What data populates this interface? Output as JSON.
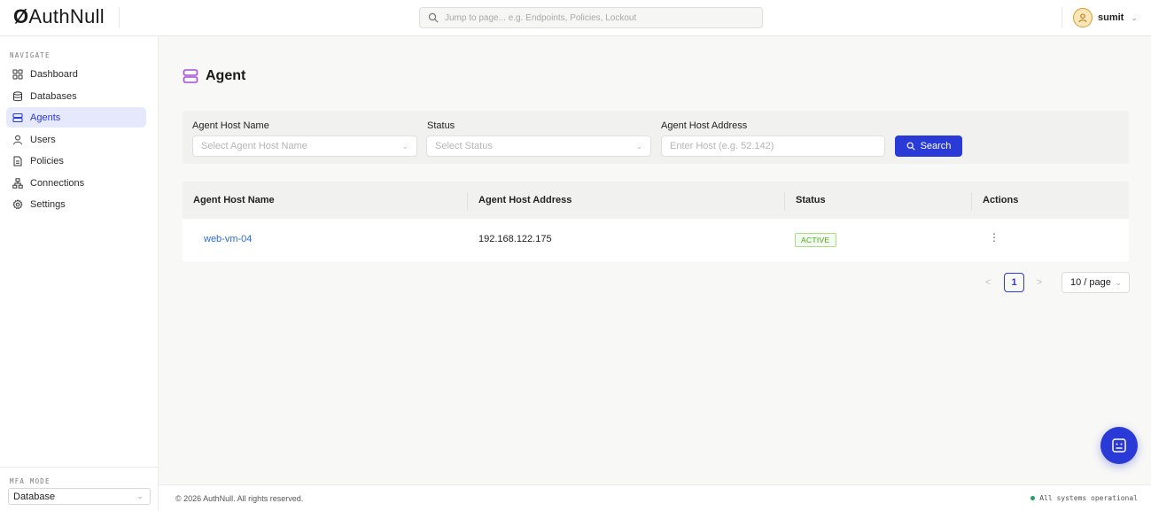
{
  "header": {
    "logo_mark": "Ø",
    "logo_text": "AuthNull",
    "search_placeholder": "Jump to page... e.g. Endpoints, Policies, Lockout",
    "user_name": "sumit"
  },
  "sidebar": {
    "section_title": "NAVIGATE",
    "items": [
      {
        "label": "Dashboard",
        "icon": "dashboard-grid-icon"
      },
      {
        "label": "Databases",
        "icon": "database-icon"
      },
      {
        "label": "Agents",
        "icon": "server-icon",
        "active": true
      },
      {
        "label": "Users",
        "icon": "user-icon"
      },
      {
        "label": "Policies",
        "icon": "document-icon"
      },
      {
        "label": "Connections",
        "icon": "network-icon"
      },
      {
        "label": "Settings",
        "icon": "gear-icon"
      }
    ],
    "mfa_title": "MFA MODE",
    "mfa_value": "Database"
  },
  "page": {
    "title": "Agent"
  },
  "filters": {
    "host_name_label": "Agent Host Name",
    "host_name_placeholder": "Select Agent Host Name",
    "status_label": "Status",
    "status_placeholder": "Select Status",
    "host_address_label": "Agent Host Address",
    "host_address_placeholder": "Enter Host (e.g. 52.142)",
    "search_button": "Search"
  },
  "table": {
    "columns": [
      "Agent Host Name",
      "Agent Host Address",
      "Status",
      "Actions"
    ],
    "rows": [
      {
        "host_name": "web-vm-04",
        "host_address": "192.168.122.175",
        "status": "ACTIVE",
        "actions": "⋮"
      }
    ]
  },
  "pagination": {
    "prev": "<",
    "current_page": "1",
    "next": ">",
    "page_size": "10 / page"
  },
  "footer": {
    "copyright": "© 2026 AuthNull. All rights reserved.",
    "system_status": "All systems operational"
  },
  "colors": {
    "accent": "#2a3ad6",
    "active_status": "#4aa51c",
    "link": "#2a6fd6"
  }
}
